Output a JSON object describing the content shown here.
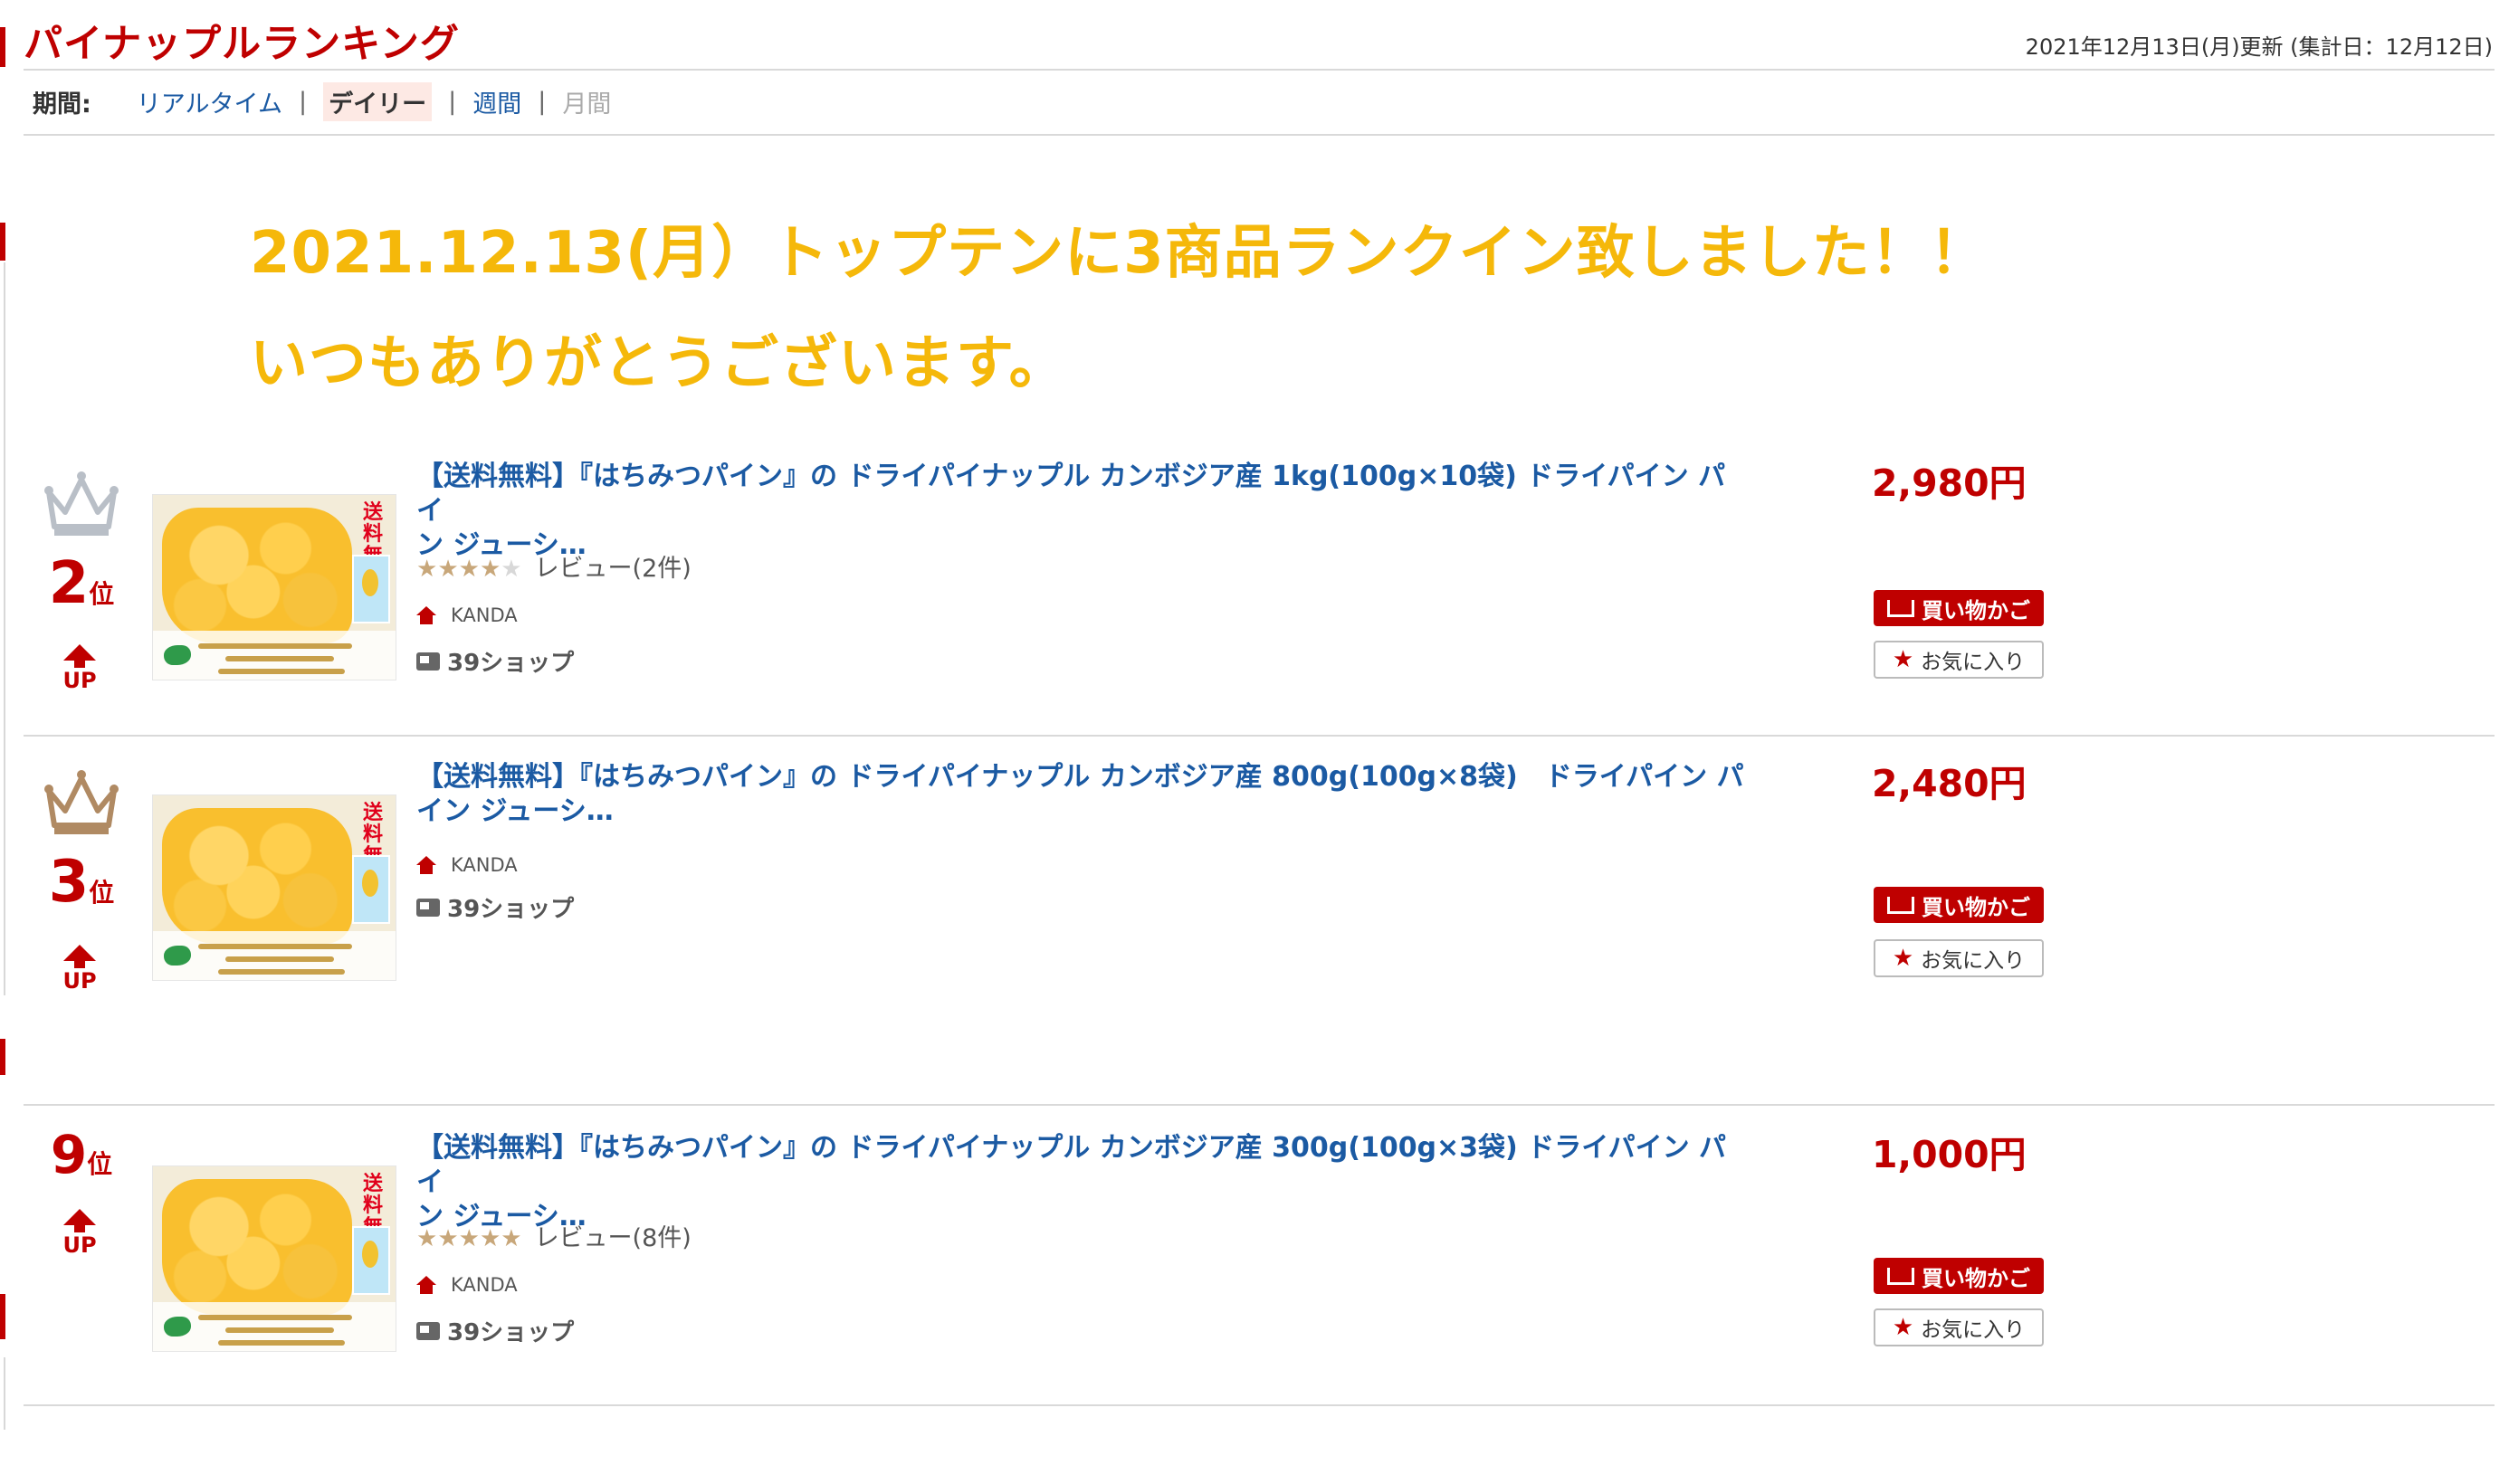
{
  "header": {
    "title": "パイナップルランキング",
    "updated": "2021年12月13日(月)更新 (集計日：12月12日)"
  },
  "period": {
    "label": "期間:",
    "options": [
      "リアルタイム",
      "デイリー",
      "週間",
      "月間"
    ],
    "separator": "|",
    "selected": "デイリー"
  },
  "banner": {
    "line1": "2021.12.13(月）トップテンに3商品ランクイン致しました！！",
    "line2": "いつもありがとうございます。",
    "color": "#f5b80a"
  },
  "colors": {
    "accent": "#bf0000",
    "link": "#1b5aa3",
    "banner": "#f5b80a"
  },
  "items": [
    {
      "rank": "2",
      "rank_unit": "位",
      "trend": "UP",
      "crown": "silver-crown-icon",
      "thumb_tag": "送料無料",
      "title_line1": "【送料無料】『はちみつパイン』の ドライパイナップル カンボジア産 1kg(100g×10袋) ドライパイン パイ",
      "title_line2": "ン ジューシ…",
      "rating": 3.5,
      "stars": "★★★★★",
      "reviews": "レビュー(2件)",
      "shop": "KANDA",
      "shipping": "39ショップ",
      "price": "2,980円",
      "cart_label": "買い物かご",
      "fav_label": "お気に入り"
    },
    {
      "rank": "3",
      "rank_unit": "位",
      "trend": "UP",
      "crown": "bronze-crown-icon",
      "thumb_tag": "送料無料",
      "title_line1": "【送料無料】『はちみつパイン』の ドライパイナップル カンボジア産 800g(100g×8袋)　ドライパイン パ",
      "title_line2": "イン ジューシ…",
      "shop": "KANDA",
      "shipping": "39ショップ",
      "price": "2,480円",
      "cart_label": "買い物かご",
      "fav_label": "お気に入り"
    },
    {
      "rank": "9",
      "rank_unit": "位",
      "trend": "UP",
      "thumb_tag": "送料無料",
      "title_line1": "【送料無料】『はちみつパイン』の ドライパイナップル カンボジア産 300g(100g×3袋) ドライパイン パイ",
      "title_line2": "ン ジューシ…",
      "rating": 4.5,
      "stars": "★★★★★",
      "reviews": "レビュー(8件)",
      "shop": "KANDA",
      "shipping": "39ショップ",
      "price": "1,000円",
      "cart_label": "買い物かご",
      "fav_label": "お気に入り"
    }
  ]
}
